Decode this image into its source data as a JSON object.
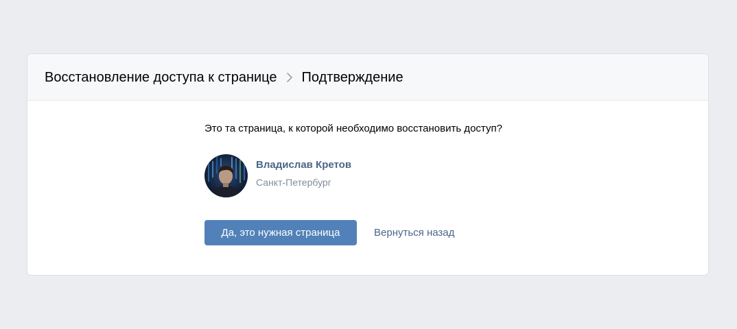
{
  "breadcrumb": {
    "items": [
      "Восстановление доступа к странице",
      "Подтверждение"
    ]
  },
  "question": "Это та страница, к которой необходимо восстановить доступ?",
  "profile": {
    "name": "Владислав Кретов",
    "city": "Санкт-Петербург"
  },
  "actions": {
    "confirm_label": "Да, это нужная страница",
    "back_label": "Вернуться назад"
  },
  "colors": {
    "page_bg": "#EBEDF0",
    "accent": "#5181B8",
    "link": "#4A6687",
    "muted": "#818C99"
  },
  "icons": {
    "separator": "chevron-right-icon"
  }
}
